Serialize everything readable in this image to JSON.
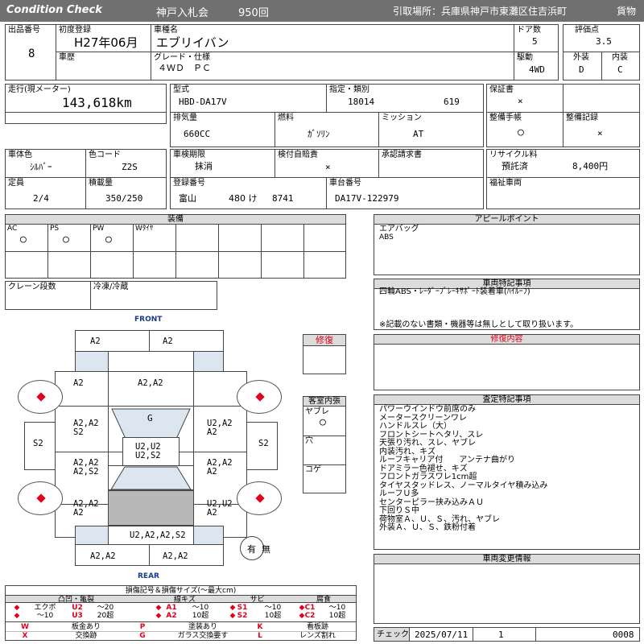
{
  "header": {
    "title_en": "Condition   Check",
    "auction": "神戸入札会",
    "session": "950回",
    "location": "引取場所：兵庫県神戸市東灘区住吉浜町",
    "category": "貨物"
  },
  "row1": {
    "lot_label": "出品番号",
    "lot": "8",
    "first_reg_label": "初度登録",
    "first_reg": "H27年06月",
    "model_label": "車種名",
    "model": "エブリイバン",
    "doors_label": "ドア数",
    "doors": "5",
    "score_label": "評価点",
    "score": "3.5",
    "history_label": "車歴",
    "grade_label": "グレード・仕様",
    "grade": "４ＷＤ　ＰＣ",
    "drive_label": "駆動",
    "drive": "4WD",
    "ext_label": "外装",
    "ext": "D",
    "int_label": "内装",
    "int": "C"
  },
  "row2": {
    "mileage_label": "走行(現メーター)",
    "mileage": "143,618km",
    "type_label": "型式",
    "type": "HBD-DA17V",
    "designation_label": "指定・類別",
    "designation": "18014",
    "classification": "619",
    "warranty_label": "保証書",
    "warranty": "×",
    "displacement_label": "排気量",
    "displacement": "660CC",
    "fuel_label": "燃料",
    "fuel": "ｶﾞｿﾘﾝ",
    "mission_label": "ミッション",
    "mission": "AT",
    "manual_label": "整備手帳",
    "manual": "○",
    "record_label": "整備記録",
    "record": "×"
  },
  "row3": {
    "color_label": "車体色",
    "color": "ｼﾙﾊﾞｰ",
    "color_code_label": "色コード",
    "color_code": "Z2S",
    "inspection_label": "車検期限",
    "inspection": "抹消",
    "liability_label": "検付自賠責",
    "liability": "×",
    "approval_label": "承認請求書",
    "recycle_label": "リサイクル料",
    "recycle_status": "預託済",
    "recycle_amount": "8,400円",
    "capacity_label": "定員",
    "capacity": "2/4",
    "load_label": "積載量",
    "load": "350/250",
    "reg_no_label": "登録番号",
    "reg_area": "富山",
    "reg_class": "480 け",
    "reg_number": "8741",
    "chassis_label": "車台番号",
    "chassis": "DA17V-122979",
    "welfare_label": "福祉車両"
  },
  "equipment": {
    "title": "装備",
    "items": [
      {
        "label": "AC",
        "value": "○"
      },
      {
        "label": "PS",
        "value": "○"
      },
      {
        "label": "PW",
        "value": "○"
      },
      {
        "label": "Wﾀｲﾔ",
        "value": ""
      }
    ],
    "crane_label": "クレーン段数",
    "fridge_label": "冷凍/冷蔵"
  },
  "appeal": {
    "title": "アピールポイント",
    "lines": [
      "エアバッグ",
      "ABS"
    ]
  },
  "special": {
    "title": "車両特記事項",
    "line1": "四輪ABS・ﾚｰﾀﾞｰﾌﾞﾚｰｷｻﾎﾟｰﾄ装着車(ﾊｲﾙｰﾌ)",
    "note": "※記載のない書類・機器等は無しとして取り扱います。"
  },
  "repair": {
    "title": "修復",
    "content_title": "修復内容"
  },
  "cabin": {
    "title": "客室内張",
    "smoke_label": "ヤブレ",
    "smoke_value": "○",
    "hole_label": "穴",
    "burn_label": "コゲ"
  },
  "inspection_notes": {
    "title": "査定特記事項",
    "lines": [
      "パワーウインドウ前席のみ",
      "メータースクリーンワレ",
      "ハンドルスレ（大）",
      "フロントシートヘタリ、スレ",
      "天張り汚れ、スレ、ヤブレ",
      "内装汚れ、キズ",
      "ルーフキャリア付　　アンテナ曲がり",
      "ドアミラー色褪せ、キズ",
      "フロントガラスワレ1cm超",
      "タイヤスタッドレス、ノーマルタイヤ積み込み",
      "ルーフＵ多",
      "センターピラー挟み込みＡＵ",
      "下回りＳ中",
      "荷物室Ａ、Ｕ、Ｓ、汚れ、ヤブレ",
      "外装Ａ、Ｕ、Ｓ、鉄粉付着"
    ]
  },
  "change_info": {
    "title": "車両変更情報"
  },
  "diagram": {
    "front": "FRONT",
    "rear": "REAR",
    "front_bumper_l": "A2",
    "front_bumper_r": "A2",
    "hood_l": "A2",
    "hood": "A2,A2",
    "windshield": "G",
    "fender_lf": "A2,A2\nS2",
    "fender_rf": "U2,A2\nA2",
    "step_l": "S2",
    "step_r": "S2",
    "roof": "U2,U2\nU2,S2",
    "door_lr": "A2,A2\nA2,S2",
    "door_rr": "A2,A2\nA2",
    "quarter_l": "A2,A2\nA2",
    "quarter_r": "U2,U2\nA2",
    "rear_gate": "U2,A2,A2,S2",
    "rear_bumper_l": "A2,A2",
    "rear_bumper_r": "A2,A2",
    "spare_label": "有",
    "spare_none": "無"
  },
  "legend": {
    "title": "損傷記号＆損傷サイズ(〜最大cm)",
    "groups": [
      "凸凹・亀裂",
      "線キズ",
      "サビ",
      "腐食"
    ],
    "row1": [
      "エクボ",
      "U2",
      "〜20",
      "A1",
      "〜10",
      "S1",
      "〜10",
      "C1",
      "〜10"
    ],
    "row2": [
      "〜10",
      "U3",
      "20超",
      "A2",
      "10超",
      "S2",
      "10超",
      "C2",
      "10超"
    ],
    "bottom": [
      [
        "W",
        "板金あり",
        "P",
        "塗装あり",
        "K",
        "看板跡"
      ],
      [
        "X",
        "交換跡",
        "G",
        "ガラス交換要す",
        "L",
        "レンズ割れ"
      ]
    ]
  },
  "check": {
    "label": "チェック",
    "date": "2025/07/11",
    "num": "1",
    "code": "0008"
  },
  "colors": {
    "header_bg": "#707070",
    "accent_red": "#e0001b",
    "panel_blue": "#dce6f0",
    "navy": "#1a3a8a"
  }
}
